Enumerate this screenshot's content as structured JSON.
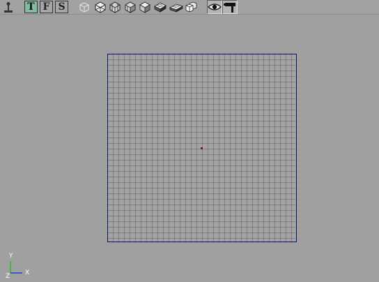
{
  "toolbar": {
    "view_buttons": [
      {
        "id": "top",
        "label": "T",
        "active": true
      },
      {
        "id": "front",
        "label": "F",
        "active": false
      },
      {
        "id": "side",
        "label": "S",
        "active": false
      }
    ],
    "icons": {
      "joystick": "joystick-icon",
      "cube_wire": "cube-wireframe-icon",
      "cube_flat": "cube-flat-icon",
      "cube_faceted": "cube-faceted-icon",
      "cube_smooth": "cube-smooth-icon",
      "cube_shaded": "cube-shaded-icon",
      "cube_textured": "cube-textured-icon",
      "book_textured": "book-textured-icon",
      "cubes_multi": "cubes-multi-icon",
      "eye": "eye-icon",
      "hammer": "hammer-icon"
    }
  },
  "axes": {
    "y_label": "Y",
    "x_label": "X",
    "z_label": "Z"
  },
  "colors": {
    "background": "#a0a0a0",
    "grid_border": "#101070",
    "grid_line": "#7e7e7e",
    "active_view_button": "#7fbfa0",
    "origin_marker": "#8a1010",
    "axis_y": "#22c022",
    "axis_x": "#2040d0"
  }
}
